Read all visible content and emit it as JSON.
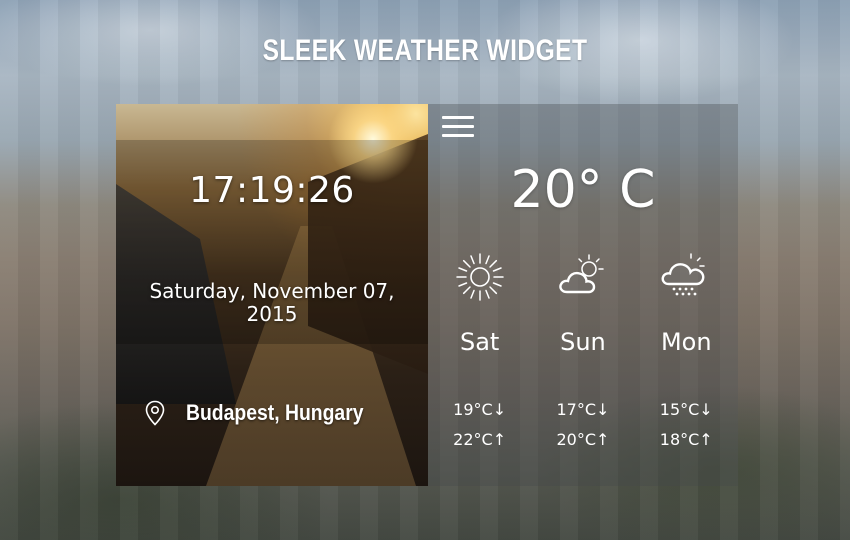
{
  "page": {
    "title": "SLEEK WEATHER WIDGET"
  },
  "widget": {
    "clock": "17:19:26",
    "date": "Saturday, November 07, 2015",
    "location": {
      "icon": "map-pin-icon",
      "text": "Budapest, Hungary"
    },
    "menu_icon": "hamburger-menu-icon",
    "current_temperature": "20° C",
    "forecast": [
      {
        "day": "Sat",
        "icon": "sun-icon",
        "low": "19°C↓",
        "high": "22°C↑"
      },
      {
        "day": "Sun",
        "icon": "partly-cloudy-icon",
        "low": "17°C↓",
        "high": "20°C↑"
      },
      {
        "day": "Mon",
        "icon": "cloud-rain-sun-icon",
        "low": "15°C↓",
        "high": "18°C↑"
      }
    ]
  },
  "colors": {
    "text": "#ffffff",
    "right_panel_overlay": "rgba(70,72,74,0.35)"
  }
}
